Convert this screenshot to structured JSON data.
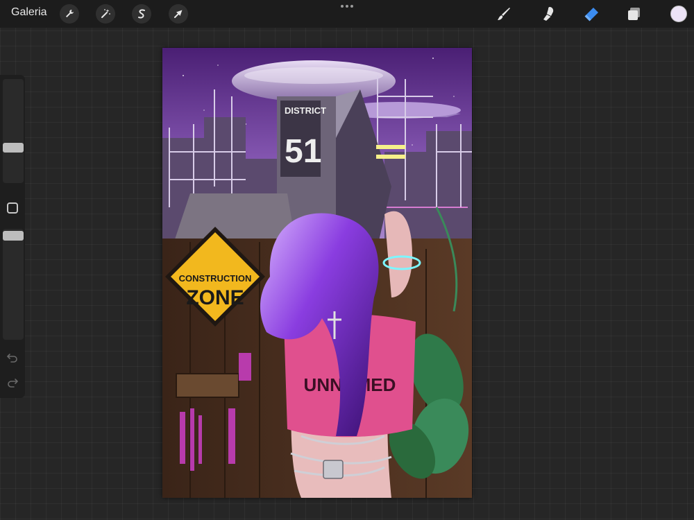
{
  "topbar": {
    "gallery_label": "Galeria",
    "actions": [
      {
        "name": "actions-wrench-icon"
      },
      {
        "name": "adjustments-wand-icon"
      },
      {
        "name": "selection-s-icon"
      },
      {
        "name": "transform-arrow-icon"
      }
    ],
    "tools": [
      {
        "name": "brush-tool-icon",
        "active": false
      },
      {
        "name": "smudge-tool-icon",
        "active": false
      },
      {
        "name": "eraser-tool-icon",
        "active": true
      },
      {
        "name": "layers-icon",
        "active": false
      }
    ],
    "current_color": "#ece3f6",
    "active_tool_color": "#3b8cf0"
  },
  "sidebar": {
    "brush_size": 0.32,
    "brush_opacity": 0.98,
    "undo_icon": "undo-icon",
    "redo_icon": "redo-icon",
    "modifier_icon": "modifier-square-icon"
  },
  "artwork": {
    "sign_line1": "CONSTRUCTION",
    "sign_line2": "ZONE",
    "tower_line1": "DISTRICT",
    "tower_line2": "51",
    "shirt_text": "UNNAMED",
    "palette": {
      "sky_top": "#5a2a86",
      "sky_bottom": "#a884c9",
      "hair": "#7b2fd0",
      "shirt": "#e0508e",
      "sign": "#f2b81e",
      "fence": "#4a3020",
      "leaves": "#2f7a4a"
    }
  }
}
